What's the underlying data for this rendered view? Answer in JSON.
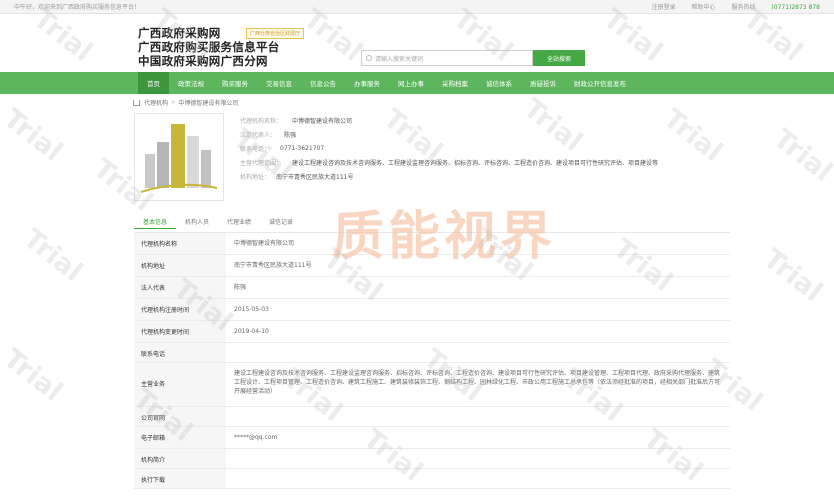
{
  "topbar": {
    "left_text": "中午好，欢迎来到广西政府购买服务信息平台！",
    "links": [
      "注册登录",
      "帮助中心",
      "服务热线"
    ],
    "phone": "(0771)2873 878"
  },
  "header": {
    "logo_lines": [
      "广西政府采购网",
      "广西政府购买服务信息平台",
      "中国政府采购网广西分网"
    ],
    "badge": "广西壮族自治区财政厅",
    "search_placeholder": "请输入搜索关键词",
    "search_button": "全站搜索"
  },
  "nav": {
    "items": [
      "首页",
      "政策法规",
      "购买服务",
      "交易信息",
      "信息公告",
      "办事服务",
      "网上办事",
      "采购档案",
      "诚信体系",
      "质疑投诉",
      "财政公开信息发布"
    ],
    "active_index": 0
  },
  "breadcrumb": {
    "items": [
      "代理机构",
      "中博德智建设有限公司"
    ]
  },
  "company": {
    "name_label": "代理机构名称：",
    "name": "中博德智建设有限公司",
    "legal_label": "法定代表人：",
    "legal": "陈强",
    "phone_label": "联系电话：",
    "phone": "0771-3621707",
    "scope_label": "主营代理范围：",
    "scope": "建设工程建设咨询及技术咨询服务、工程建设监理咨询服务、招标咨询、评标咨询、工程造价咨询、建设项目可行性研究评估、项目建设等",
    "address_label": "机构地址：",
    "address": "南宁市青秀区民族大道111号"
  },
  "tabs": {
    "items": [
      "基本信息",
      "机构人员",
      "代理业绩",
      "诚信记录"
    ],
    "active_index": 0
  },
  "details": [
    {
      "label": "代理机构名称",
      "value": "中博德智建设有限公司"
    },
    {
      "label": "机构地址",
      "value": "南宁市青秀区民族大道111号"
    },
    {
      "label": "法人代表",
      "value": "陈强"
    },
    {
      "label": "代理机构注册时间",
      "value": "2015-05-03"
    },
    {
      "label": "代理机构变更时间",
      "value": "2019-04-10"
    },
    {
      "label": "联系电话",
      "value": ""
    },
    {
      "label": "主营业务",
      "value": "建设工程建设咨询及技术咨询服务、工程建设监理咨询服务、招标咨询、评标咨询、工程造价咨询、建设项目可行性研究评估、项目建设管理、工程项目代理、政府采购代理服务、建筑工程设计、工程项目管理、工程造价咨询、建筑工程施工、建筑装修装饰工程、钢结构工程、园林绿化工程、市政公用工程施工总承包等（依法须经批准的项目，经相关部门批准后方可开展经营活动）"
    },
    {
      "label": "公司官网",
      "value": ""
    },
    {
      "label": "电子邮箱",
      "value": "*****@qq.com"
    },
    {
      "label": "机构简介",
      "value": ""
    },
    {
      "label": "执行下载",
      "value": ""
    }
  ],
  "watermark": {
    "brand": "质能视界",
    "trial": "Trial"
  },
  "colors": {
    "nav_green": "#5db55d",
    "nav_active": "#3d963d",
    "accent_green": "#45a845",
    "watermark_orange": "#f6c6a8"
  }
}
